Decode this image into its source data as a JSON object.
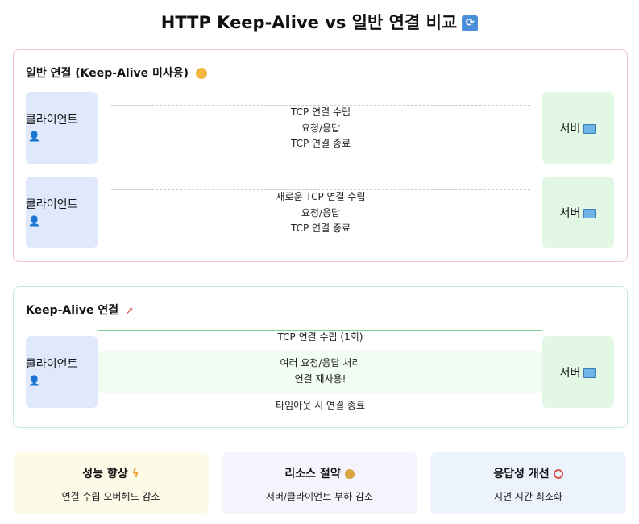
{
  "title": "HTTP Keep-Alive vs 일반 연결 비교",
  "title_icon": "🔄",
  "normal": {
    "title": "일반 연결 (Keep-Alive 미사용)",
    "title_icon": "😫",
    "client_label": "클라이언트",
    "server_label": "서버",
    "row1": [
      "TCP 연결 수립",
      "요청/응답",
      "TCP 연결 종료"
    ],
    "row2": [
      "새로운 TCP 연결 수립",
      "요청/응답",
      "TCP 연결 종료"
    ]
  },
  "keepalive": {
    "title": "Keep-Alive 연결",
    "title_icon": "🚀",
    "client_label": "클라이언트",
    "server_label": "서버",
    "establish": "TCP 연결 수립 (1회)",
    "multi": "여러 요청/응답 처리",
    "reuse": "연결 재사용!",
    "timeout": "타임아웃 시 연결 종료"
  },
  "cards": [
    {
      "title": "성능 향상",
      "icon": "⚡",
      "desc": "연결 수립 오버헤드 감소",
      "bg": "#fdfbe8"
    },
    {
      "title": "리소스 절약",
      "icon": "💰",
      "desc": "서버/클라이언트 부하 감소",
      "bg": "#f6f3fc"
    },
    {
      "title": "응답성 개선",
      "icon": "🎯",
      "desc": "지연 시간 최소화",
      "bg": "#edf3fd"
    }
  ]
}
